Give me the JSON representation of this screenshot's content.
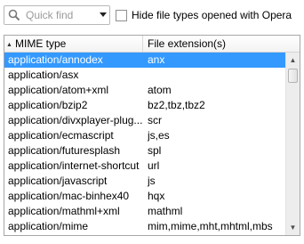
{
  "toolbar": {
    "search_placeholder": "Quick find",
    "hide_checkbox_label": "Hide file types opened with Opera",
    "hide_checkbox_checked": false
  },
  "table": {
    "columns": [
      "MIME type",
      "File extension(s)"
    ],
    "sort_column": "MIME type",
    "sort_direction": "ascending",
    "rows": [
      {
        "mime": "application/annodex",
        "ext": "anx",
        "selected": true
      },
      {
        "mime": "application/asx",
        "ext": "",
        "selected": false
      },
      {
        "mime": "application/atom+xml",
        "ext": "atom",
        "selected": false
      },
      {
        "mime": "application/bzip2",
        "ext": "bz2,tbz,tbz2",
        "selected": false
      },
      {
        "mime": "application/divxplayer-plug...",
        "ext": "scr",
        "selected": false
      },
      {
        "mime": "application/ecmascript",
        "ext": "js,es",
        "selected": false
      },
      {
        "mime": "application/futuresplash",
        "ext": "spl",
        "selected": false
      },
      {
        "mime": "application/internet-shortcut",
        "ext": "url",
        "selected": false
      },
      {
        "mime": "application/javascript",
        "ext": "js",
        "selected": false
      },
      {
        "mime": "application/mac-binhex40",
        "ext": "hqx",
        "selected": false
      },
      {
        "mime": "application/mathml+xml",
        "ext": "mathml",
        "selected": false
      },
      {
        "mime": "application/mime",
        "ext": "mim,mime,mht,mhtml,mbs",
        "selected": false
      }
    ]
  },
  "icons": {
    "search": "magnifier-icon",
    "dropdown": "triangle-down-icon",
    "sort": "triangle-up-icon",
    "scroll_up": "triangle-up-icon",
    "scroll_down": "triangle-down-icon"
  },
  "colors": {
    "selection": "#3399ff",
    "selection_text": "#ffffff",
    "placeholder": "#9a9a9a"
  }
}
